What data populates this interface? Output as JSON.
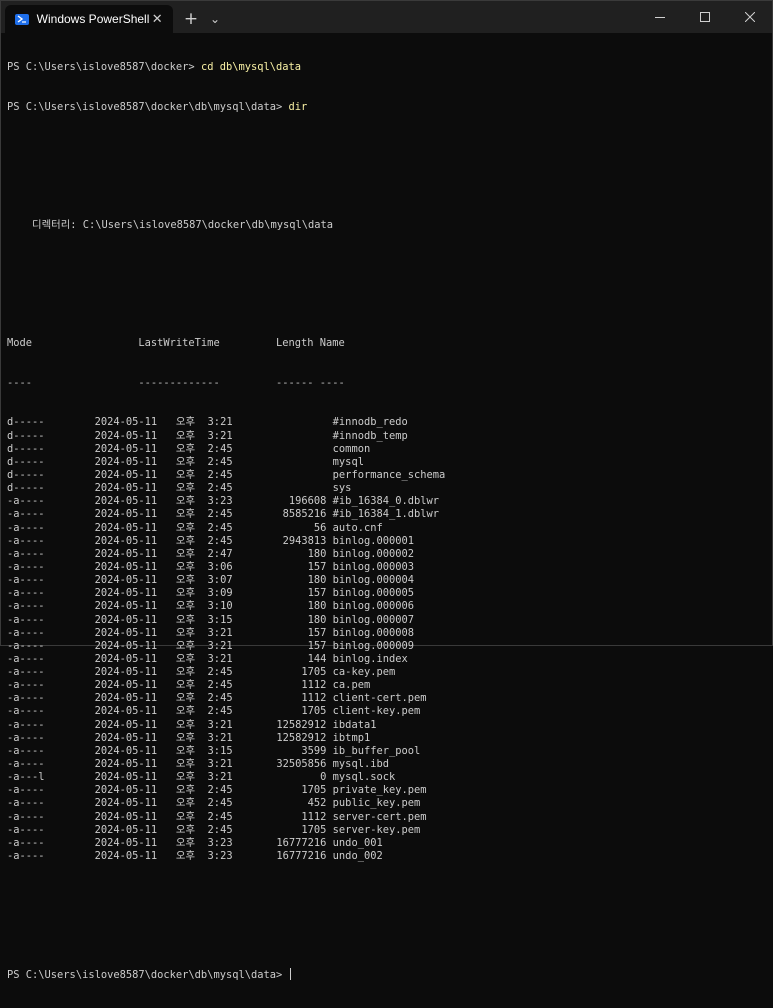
{
  "window": {
    "tab_title": "Windows PowerShell",
    "tab_close": "✕",
    "new_tab": "+",
    "dropdown": "⌄"
  },
  "terminal": {
    "prompt1": "PS C:\\Users\\islove8587\\docker> ",
    "cmd1": "cd db\\mysql\\data",
    "prompt2": "PS C:\\Users\\islove8587\\docker\\db\\mysql\\data> ",
    "cmd2": "dir",
    "directory_line": "    디렉터리: C:\\Users\\islove8587\\docker\\db\\mysql\\data",
    "header": "Mode                 LastWriteTime         Length Name",
    "header_dashes": "----                 -------------         ------ ----",
    "rows": [
      {
        "mode": "d-----",
        "date": "2024-05-11",
        "ampm": "오후",
        "time": "3:21",
        "length": "",
        "name": "#innodb_redo"
      },
      {
        "mode": "d-----",
        "date": "2024-05-11",
        "ampm": "오후",
        "time": "3:21",
        "length": "",
        "name": "#innodb_temp"
      },
      {
        "mode": "d-----",
        "date": "2024-05-11",
        "ampm": "오후",
        "time": "2:45",
        "length": "",
        "name": "common"
      },
      {
        "mode": "d-----",
        "date": "2024-05-11",
        "ampm": "오후",
        "time": "2:45",
        "length": "",
        "name": "mysql"
      },
      {
        "mode": "d-----",
        "date": "2024-05-11",
        "ampm": "오후",
        "time": "2:45",
        "length": "",
        "name": "performance_schema"
      },
      {
        "mode": "d-----",
        "date": "2024-05-11",
        "ampm": "오후",
        "time": "2:45",
        "length": "",
        "name": "sys"
      },
      {
        "mode": "-a----",
        "date": "2024-05-11",
        "ampm": "오후",
        "time": "3:23",
        "length": "196608",
        "name": "#ib_16384_0.dblwr"
      },
      {
        "mode": "-a----",
        "date": "2024-05-11",
        "ampm": "오후",
        "time": "2:45",
        "length": "8585216",
        "name": "#ib_16384_1.dblwr"
      },
      {
        "mode": "-a----",
        "date": "2024-05-11",
        "ampm": "오후",
        "time": "2:45",
        "length": "56",
        "name": "auto.cnf"
      },
      {
        "mode": "-a----",
        "date": "2024-05-11",
        "ampm": "오후",
        "time": "2:45",
        "length": "2943813",
        "name": "binlog.000001"
      },
      {
        "mode": "-a----",
        "date": "2024-05-11",
        "ampm": "오후",
        "time": "2:47",
        "length": "180",
        "name": "binlog.000002"
      },
      {
        "mode": "-a----",
        "date": "2024-05-11",
        "ampm": "오후",
        "time": "3:06",
        "length": "157",
        "name": "binlog.000003"
      },
      {
        "mode": "-a----",
        "date": "2024-05-11",
        "ampm": "오후",
        "time": "3:07",
        "length": "180",
        "name": "binlog.000004"
      },
      {
        "mode": "-a----",
        "date": "2024-05-11",
        "ampm": "오후",
        "time": "3:09",
        "length": "157",
        "name": "binlog.000005"
      },
      {
        "mode": "-a----",
        "date": "2024-05-11",
        "ampm": "오후",
        "time": "3:10",
        "length": "180",
        "name": "binlog.000006"
      },
      {
        "mode": "-a----",
        "date": "2024-05-11",
        "ampm": "오후",
        "time": "3:15",
        "length": "180",
        "name": "binlog.000007"
      },
      {
        "mode": "-a----",
        "date": "2024-05-11",
        "ampm": "오후",
        "time": "3:21",
        "length": "157",
        "name": "binlog.000008"
      },
      {
        "mode": "-a----",
        "date": "2024-05-11",
        "ampm": "오후",
        "time": "3:21",
        "length": "157",
        "name": "binlog.000009"
      },
      {
        "mode": "-a----",
        "date": "2024-05-11",
        "ampm": "오후",
        "time": "3:21",
        "length": "144",
        "name": "binlog.index"
      },
      {
        "mode": "-a----",
        "date": "2024-05-11",
        "ampm": "오후",
        "time": "2:45",
        "length": "1705",
        "name": "ca-key.pem"
      },
      {
        "mode": "-a----",
        "date": "2024-05-11",
        "ampm": "오후",
        "time": "2:45",
        "length": "1112",
        "name": "ca.pem"
      },
      {
        "mode": "-a----",
        "date": "2024-05-11",
        "ampm": "오후",
        "time": "2:45",
        "length": "1112",
        "name": "client-cert.pem"
      },
      {
        "mode": "-a----",
        "date": "2024-05-11",
        "ampm": "오후",
        "time": "2:45",
        "length": "1705",
        "name": "client-key.pem"
      },
      {
        "mode": "-a----",
        "date": "2024-05-11",
        "ampm": "오후",
        "time": "3:21",
        "length": "12582912",
        "name": "ibdata1"
      },
      {
        "mode": "-a----",
        "date": "2024-05-11",
        "ampm": "오후",
        "time": "3:21",
        "length": "12582912",
        "name": "ibtmp1"
      },
      {
        "mode": "-a----",
        "date": "2024-05-11",
        "ampm": "오후",
        "time": "3:15",
        "length": "3599",
        "name": "ib_buffer_pool"
      },
      {
        "mode": "-a----",
        "date": "2024-05-11",
        "ampm": "오후",
        "time": "3:21",
        "length": "32505856",
        "name": "mysql.ibd"
      },
      {
        "mode": "-a---l",
        "date": "2024-05-11",
        "ampm": "오후",
        "time": "3:21",
        "length": "0",
        "name": "mysql.sock"
      },
      {
        "mode": "-a----",
        "date": "2024-05-11",
        "ampm": "오후",
        "time": "2:45",
        "length": "1705",
        "name": "private_key.pem"
      },
      {
        "mode": "-a----",
        "date": "2024-05-11",
        "ampm": "오후",
        "time": "2:45",
        "length": "452",
        "name": "public_key.pem"
      },
      {
        "mode": "-a----",
        "date": "2024-05-11",
        "ampm": "오후",
        "time": "2:45",
        "length": "1112",
        "name": "server-cert.pem"
      },
      {
        "mode": "-a----",
        "date": "2024-05-11",
        "ampm": "오후",
        "time": "2:45",
        "length": "1705",
        "name": "server-key.pem"
      },
      {
        "mode": "-a----",
        "date": "2024-05-11",
        "ampm": "오후",
        "time": "3:23",
        "length": "16777216",
        "name": "undo_001"
      },
      {
        "mode": "-a----",
        "date": "2024-05-11",
        "ampm": "오후",
        "time": "3:23",
        "length": "16777216",
        "name": "undo_002"
      }
    ],
    "prompt3": "PS C:\\Users\\islove8587\\docker\\db\\mysql\\data> "
  },
  "colors": {
    "background": "#0c0c0c",
    "titlebar": "#202020",
    "text": "#cccccc",
    "command": "#f9f1a5"
  }
}
